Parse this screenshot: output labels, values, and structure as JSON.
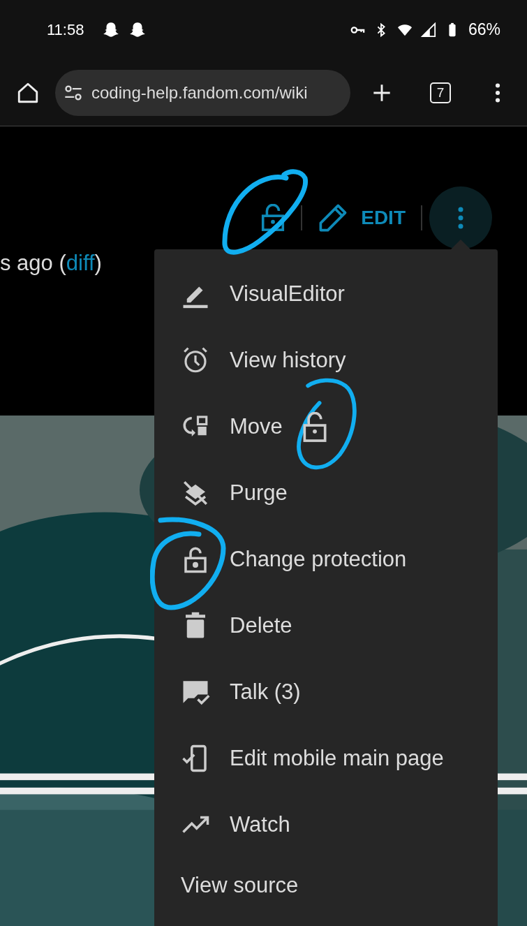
{
  "status_bar": {
    "time": "11:58",
    "battery": "66%"
  },
  "browser": {
    "url": "coding-help.fandom.com/wiki",
    "tab_count": "7"
  },
  "page": {
    "edit_label": "EDIT",
    "revision": {
      "prefix": "s ago (",
      "link": "diff",
      "suffix": ")"
    }
  },
  "menu": {
    "items": [
      {
        "label": "VisualEditor",
        "kind": "pencil"
      },
      {
        "label": "View history",
        "kind": "clock"
      },
      {
        "label": "Move",
        "kind": "move"
      },
      {
        "label": "Purge",
        "kind": "purge"
      },
      {
        "label": "Change protection",
        "kind": "lock"
      },
      {
        "label": "Delete",
        "kind": "trash"
      },
      {
        "label": "Talk (3)",
        "kind": "talk"
      },
      {
        "label": "Edit mobile main page",
        "kind": "mobile"
      },
      {
        "label": "Watch",
        "kind": "trend"
      },
      {
        "label": "View source",
        "kind": "none"
      }
    ]
  }
}
